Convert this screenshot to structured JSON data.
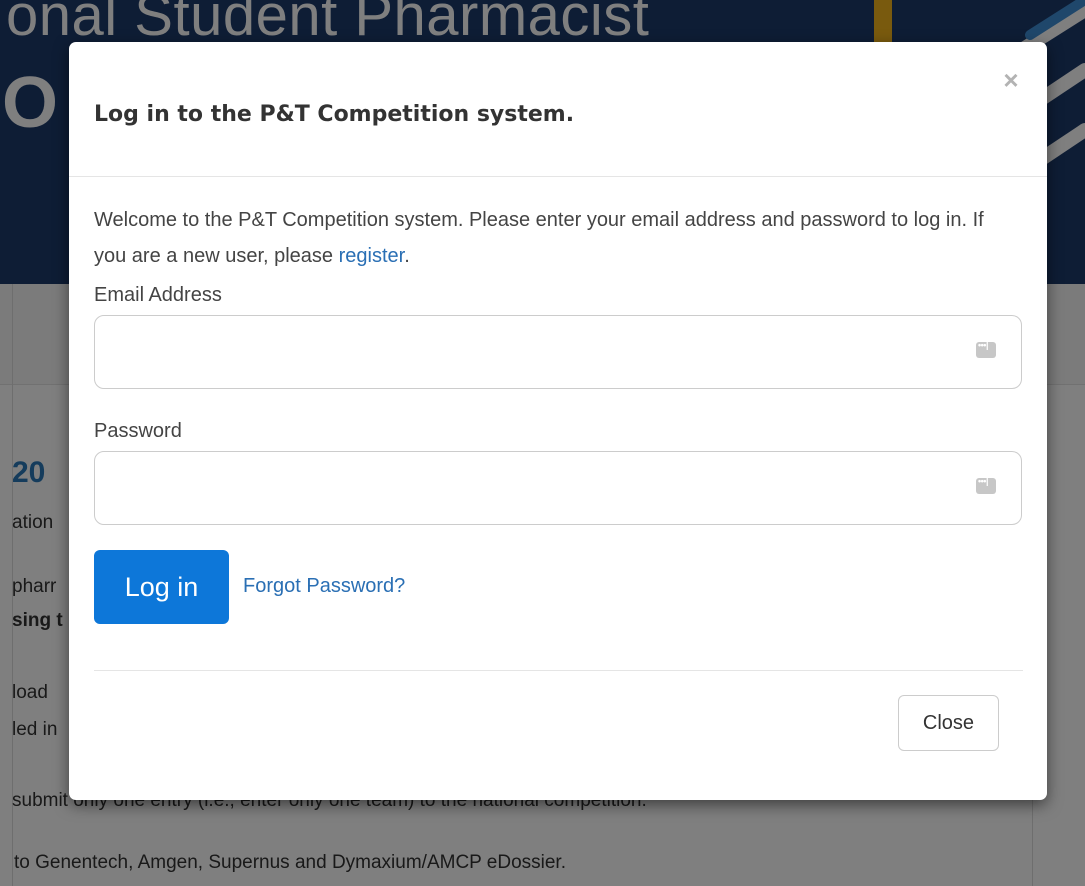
{
  "background": {
    "header_title_fragment": "onal Student Pharmacist",
    "header_sub_fragment": "O",
    "heading_fragment": "20",
    "lines": [
      {
        "text": "ation",
        "bold": false
      },
      {
        "text": "pharr",
        "bold": false
      },
      {
        "text": "sing t",
        "bold": true
      },
      {
        "text": "load",
        "bold": false
      },
      {
        "text": "led in",
        "bold": false
      },
      {
        "text": "submit only one entry (i.e., enter only one team) to the national competition.",
        "bold": false
      },
      {
        "text": "to Genentech, Amgen, Supernus and Dymaxium/AMCP eDossier.",
        "bold": false
      }
    ]
  },
  "modal": {
    "title": "Log in to the P&T Competition system.",
    "close_icon": "×",
    "intro_text": "Welcome to the P&T Competition system. Please enter your email address and password to log in. If you are a new user, please ",
    "register_link": "register",
    "intro_end": ".",
    "email": {
      "label": "Email Address",
      "value": "",
      "placeholder": ""
    },
    "password": {
      "label": "Password",
      "value": "",
      "placeholder": ""
    },
    "login_button": "Log in",
    "forgot_link": "Forgot Password?",
    "close_button": "Close"
  },
  "colors": {
    "header_bg": "#1d3a6b",
    "primary_button": "#0d77d9",
    "link": "#2a6fb4",
    "accent_yellow": "#f2b51c"
  }
}
